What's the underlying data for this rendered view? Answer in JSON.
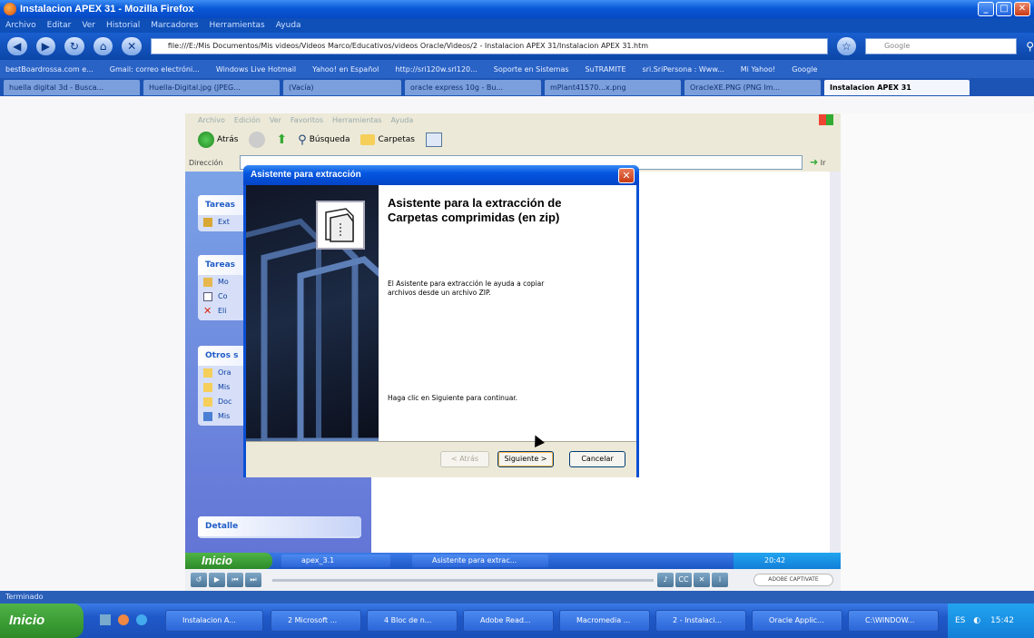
{
  "firefox": {
    "title": "Instalacion APEX 31 - Mozilla Firefox",
    "menu": [
      "Archivo",
      "Editar",
      "Ver",
      "Historial",
      "Marcadores",
      "Herramientas",
      "Ayuda"
    ],
    "url": "file:///E:/Mis Documentos/Mis videos/Videos Marco/Educativos/videos Oracle/Videos/2 - Instalacion APEX 31/Instalacion APEX 31.htm",
    "search_placeholder": "Google",
    "bookmarks": [
      "bestBoardrossa.com e...",
      "Gmail: correo electróni...",
      "Windows Live Hotmail",
      "Yahoo! en Español",
      "http://sri120w.srl120...",
      "Soporte en Sistemas",
      "SuTRAMITE",
      "sri.SriPersona : Www...",
      "Mi Yahoo!",
      "Google"
    ],
    "tabs": [
      {
        "label": "huella digital 3d - Busca...",
        "active": false
      },
      {
        "label": "Huella-Digital.jpg (JPEG...",
        "active": false
      },
      {
        "label": "(Vacía)",
        "active": false
      },
      {
        "label": "oracle express 10g - Bu...",
        "active": false
      },
      {
        "label": "mPlant41570...x.png",
        "active": false
      },
      {
        "label": "OracleXE.PNG (PNG Im...",
        "active": false
      },
      {
        "label": "Instalacion APEX 31",
        "active": true
      }
    ],
    "status": "Terminado"
  },
  "explorer": {
    "menu": [
      "Archivo",
      "Edición",
      "Ver",
      "Favoritos",
      "Herramientas",
      "Ayuda"
    ],
    "toolbar": {
      "back": "Atrás",
      "search": "Búsqueda",
      "folders": "Carpetas"
    },
    "address_label": "Dirección",
    "go_label": "Ir",
    "panels": [
      {
        "title": "Tareas",
        "items": [
          "Ext"
        ]
      },
      {
        "title": "Tareas",
        "items": [
          "Mo",
          "Co",
          "Eli"
        ]
      },
      {
        "title": "Otros s",
        "items": [
          "Ora",
          "Mis",
          "Doc",
          "Mis"
        ]
      },
      {
        "title": "Detalle",
        "items": []
      }
    ]
  },
  "dialog": {
    "title": "Asistente para extracción",
    "heading": "Asistente para la extracción de Carpetas comprimidas (en zip)",
    "description": "El Asistente para extracción le ayuda a copiar archivos desde un archivo ZIP.",
    "hint": "Haga clic en Siguiente para continuar.",
    "back_label": "< Atrás",
    "next_label": "Siguiente >",
    "cancel_label": "Cancelar"
  },
  "inner_taskbar": {
    "start": "Inicio",
    "tasks": [
      "apex_3.1",
      "Asistente para extrac..."
    ],
    "clock": "20:42"
  },
  "player": {
    "brand": "ADOBE CAPTIVATE"
  },
  "taskbar": {
    "start": "Inicio",
    "tasks": [
      "Instalacion A...",
      "2 Microsoft ...",
      "4 Bloc de n...",
      "Adobe Read...",
      "Macromedia ...",
      "2 - Instalaci...",
      "Oracle Applic...",
      "C:\\WINDOW..."
    ],
    "lang": "ES",
    "clock": "15:42"
  }
}
